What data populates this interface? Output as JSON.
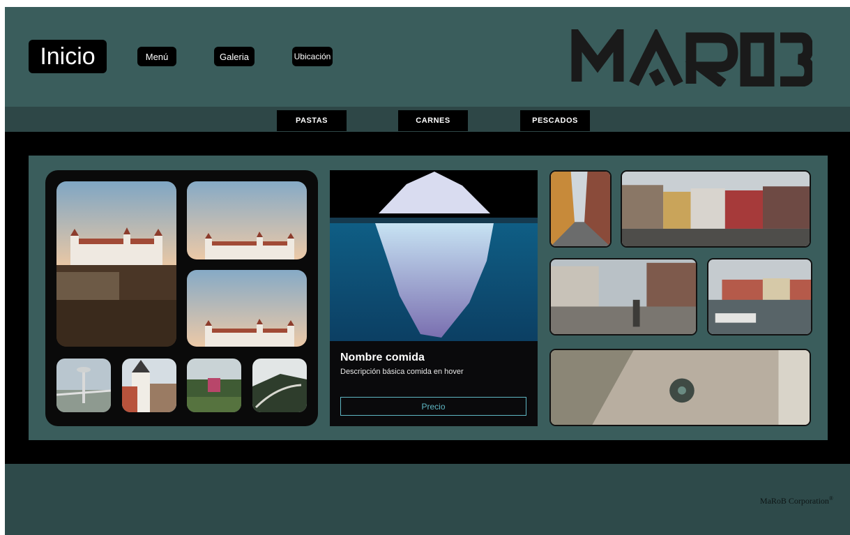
{
  "nav": {
    "home": "Inicio",
    "menu": "Menú",
    "gallery": "Galeria",
    "location": "Ubicación"
  },
  "logo": {
    "text": "MAROB",
    "color": "#1a1a1a"
  },
  "categories": [
    "PASTAS",
    "CARNES",
    "PESCADOS"
  ],
  "card": {
    "title": "Nombre comida",
    "description": "Descripción básica comida en hover",
    "price_label": "Precio"
  },
  "footer": {
    "copyright": "MaRoB Corporation",
    "mark": "®"
  },
  "colors": {
    "header": "#3a5d5c",
    "bar": "#2e4747",
    "accent": "#5fb7c4"
  }
}
